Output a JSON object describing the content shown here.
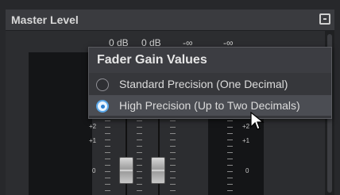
{
  "panel": {
    "title": "Master Level"
  },
  "meter_labels": {
    "peak_left": "0 dB",
    "peak_right": "0 dB",
    "rms_left": "-∞",
    "rms_right": "-∞"
  },
  "scale": {
    "left_marks": [
      "+2",
      "+1",
      "0"
    ],
    "right_marks": [
      "+2",
      "+1",
      "0"
    ]
  },
  "popup": {
    "title": "Fader Gain Values",
    "options": [
      {
        "label": "Standard Precision (One Decimal)",
        "selected": false
      },
      {
        "label": "High Precision (Up to Two Decimals)",
        "selected": true
      }
    ]
  },
  "colors": {
    "accent": "#5aa7e8",
    "popup_bg": "#36373b",
    "selected_row": "#4b4d53"
  },
  "icons": {
    "panel_menu": "menu-square-icon",
    "cursor": "mouse-pointer-icon"
  }
}
